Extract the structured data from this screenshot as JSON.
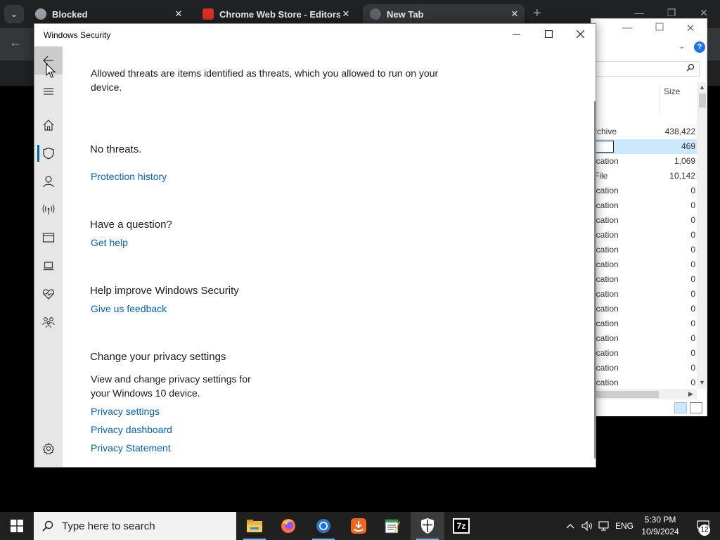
{
  "browser": {
    "tabs": [
      {
        "title": "Blocked",
        "active": false
      },
      {
        "title": "Chrome Web Store - Editors' P",
        "active": false
      },
      {
        "title": "New Tab",
        "active": true
      }
    ],
    "new_tab_glyph": "+",
    "close_glyph": "✕",
    "menu_glyph": "⌄",
    "controls": {
      "minimize": "—",
      "restore": "❐",
      "close": "✕"
    },
    "back_glyph": "←"
  },
  "explorer": {
    "column_header": "Size",
    "rows": [
      {
        "type": "rchive",
        "size": "438,422",
        "selected": false
      },
      {
        "type": "",
        "size": "469",
        "selected": true
      },
      {
        "type": "ication",
        "size": "1,069",
        "selected": false
      },
      {
        "type": "File",
        "size": "10,142",
        "selected": false
      },
      {
        "type": "ication",
        "size": "0",
        "selected": false
      },
      {
        "type": "ication",
        "size": "0",
        "selected": false
      },
      {
        "type": "ication",
        "size": "0",
        "selected": false
      },
      {
        "type": "ication",
        "size": "0",
        "selected": false
      },
      {
        "type": "ication",
        "size": "0",
        "selected": false
      },
      {
        "type": "ication",
        "size": "0",
        "selected": false
      },
      {
        "type": "ication",
        "size": "0",
        "selected": false
      },
      {
        "type": "ication",
        "size": "0",
        "selected": false
      },
      {
        "type": "ication",
        "size": "0",
        "selected": false
      },
      {
        "type": "ication",
        "size": "0",
        "selected": false
      },
      {
        "type": "ication",
        "size": "0",
        "selected": false
      },
      {
        "type": "ication",
        "size": "0",
        "selected": false
      },
      {
        "type": "ication",
        "size": "0",
        "selected": false
      },
      {
        "type": "ication",
        "size": "0",
        "selected": false
      }
    ],
    "help_glyph": "?"
  },
  "security": {
    "window_title": "Windows Security",
    "intro": "Allowed threats are items identified as threats, which you allowed to run on your device.",
    "no_threats": "No threats.",
    "protection_history_link": "Protection history",
    "question_heading": "Have a question?",
    "get_help_link": "Get help",
    "improve_heading": "Help improve Windows Security",
    "feedback_link": "Give us feedback",
    "privacy_heading": "Change your privacy settings",
    "privacy_body": "View and change privacy settings for your Windows 10 device.",
    "privacy_settings_link": "Privacy settings",
    "privacy_dashboard_link": "Privacy dashboard",
    "privacy_statement_link": "Privacy Statement",
    "nav_icons": [
      "back-arrow-icon",
      "hamburger-menu-icon",
      "home-icon",
      "shield-icon",
      "person-icon",
      "wireless-antenna-icon",
      "app-browser-icon",
      "laptop-icon",
      "heart-pulse-icon",
      "family-icon",
      "settings-gear-icon"
    ],
    "accent_color": "#0063b1"
  },
  "taskbar": {
    "search_placeholder": "Type here to search",
    "apps": [
      "file-explorer-icon",
      "firefox-icon",
      "chrome-icon",
      "downloader-icon",
      "notepad-icon",
      "windows-security-icon",
      "7zip-icon"
    ],
    "seven_zip_label": "7z",
    "language": "ENG",
    "time": "5:30 PM",
    "date": "10/9/2024",
    "notification_count": "12"
  }
}
